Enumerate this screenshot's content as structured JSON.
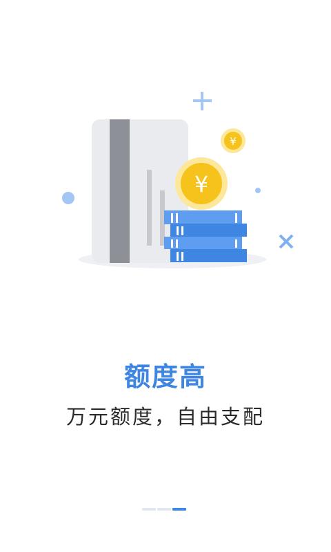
{
  "onboarding": {
    "title": "额度高",
    "subtitle": "万元额度，自由支配",
    "coin_symbol": "¥",
    "page_indicator": {
      "total_pages": 3,
      "current_page": 3
    }
  },
  "colors": {
    "accent": "#3f86e3",
    "text_dark": "#2b2b2b",
    "coin_gold": "#f6c21c",
    "coin_halo": "#fde79a",
    "card_gray": "#eaebee",
    "card_stripe": "#8e9097",
    "book_blue": "#3f86e3"
  }
}
